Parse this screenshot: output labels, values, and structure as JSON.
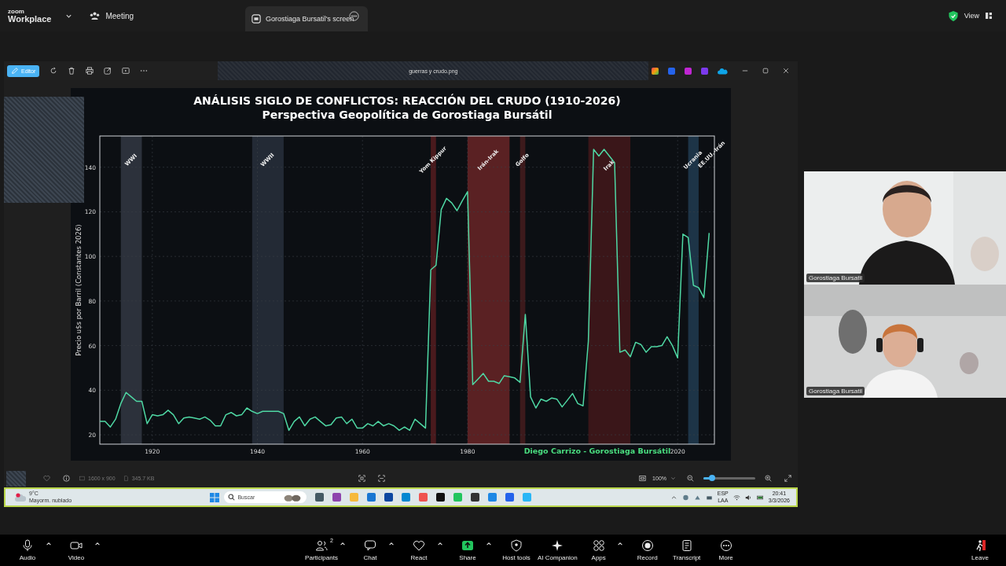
{
  "top_bar": {
    "logo_small": "zoom",
    "logo": "Workplace",
    "meeting": "Meeting",
    "share_tab": "Gorostiaga Bursatil's screen",
    "view": "View"
  },
  "viewer": {
    "editor_button": "Editor",
    "filename": "guerras y crudo.png",
    "image": {
      "subtitle": "Perspectiva Geopolítica de Gorostiaga Bursátil",
      "credit": "Diego Carrizo - Gorostiaga Bursátil",
      "chart_data": {
        "type": "line",
        "title": "ANÁLISIS SIGLO DE CONFLICTOS: REACCIÓN DEL CRUDO (1910-2026)",
        "ylabel": "Precio u$s por Barril (Constantes 2026)",
        "xlim": [
          1910,
          2027
        ],
        "ylim": [
          15.8,
          154
        ],
        "xticks": [
          1920,
          1940,
          1960,
          1980,
          2020
        ],
        "yticks": [
          20,
          40,
          60,
          80,
          100,
          120,
          140
        ],
        "x": [
          1910,
          1911,
          1912,
          1913,
          1914,
          1915,
          1916,
          1917,
          1918,
          1919,
          1920,
          1921,
          1922,
          1923,
          1924,
          1925,
          1926,
          1927,
          1928,
          1929,
          1930,
          1931,
          1932,
          1933,
          1934,
          1935,
          1936,
          1937,
          1938,
          1939,
          1940,
          1941,
          1942,
          1943,
          1944,
          1945,
          1946,
          1947,
          1948,
          1949,
          1950,
          1951,
          1952,
          1953,
          1954,
          1955,
          1956,
          1957,
          1958,
          1959,
          1960,
          1961,
          1962,
          1963,
          1964,
          1965,
          1966,
          1967,
          1968,
          1969,
          1970,
          1971,
          1972,
          1973,
          1974,
          1975,
          1976,
          1977,
          1978,
          1979,
          1980,
          1981,
          1982,
          1983,
          1984,
          1985,
          1986,
          1987,
          1988,
          1989,
          1990,
          1991,
          1992,
          1993,
          1994,
          1995,
          1996,
          1997,
          1998,
          1999,
          2000,
          2001,
          2002,
          2003,
          2004,
          2005,
          2006,
          2007,
          2008,
          2009,
          2010,
          2011,
          2012,
          2013,
          2014,
          2015,
          2016,
          2017,
          2018,
          2019,
          2020,
          2021,
          2022,
          2023,
          2024,
          2025,
          2026
        ],
        "series": [
          {
            "color": "#4fd8a4",
            "values": [
              26,
              26,
              23.5,
              27,
              34,
              39,
              37,
              35,
              35,
              25,
              29,
              28.5,
              29,
              31,
              29,
              25,
              27.5,
              28,
              27.5,
              27,
              28,
              26.5,
              24,
              24,
              29,
              30,
              28.5,
              29,
              32,
              30.5,
              29.5,
              30.5,
              30.5,
              30.5,
              30.5,
              29.5,
              22,
              26,
              28,
              24,
              27,
              28,
              26,
              24,
              24.5,
              27.5,
              28,
              25,
              27,
              23,
              23,
              25,
              24,
              26,
              24,
              25,
              24,
              22,
              23.5,
              22,
              27,
              25,
              23,
              94,
              96,
              121,
              126,
              124,
              120.5,
              125,
              129,
              42.5,
              45,
              47.5,
              44,
              44,
              43,
              46.5,
              46,
              45.5,
              43.5,
              74,
              37,
              32,
              36,
              35,
              36.5,
              36,
              32.5,
              35.5,
              38.5,
              34,
              33,
              62,
              148,
              145,
              148,
              145,
              142,
              57,
              58,
              55,
              61.5,
              60.5,
              57,
              59.5,
              59.5,
              60,
              64,
              60,
              54.5,
              110,
              108.5,
              87,
              86,
              81.5,
              110.5
            ]
          }
        ],
        "grid": true,
        "bands": [
          {
            "axis": "x",
            "from": 1914,
            "to": 1918,
            "label": "WWI",
            "color": "#2c313b"
          },
          {
            "axis": "x",
            "from": 1939,
            "to": 1945,
            "label": "WWII",
            "color": "#232a35"
          },
          {
            "axis": "x",
            "from": 1973,
            "to": 1974,
            "label": "Yom Kippur",
            "color": "#4a1a1d"
          },
          {
            "axis": "x",
            "from": 1980,
            "to": 1988,
            "label": "Irán-Irak",
            "color": "#5a2123"
          },
          {
            "axis": "x",
            "from": 1990,
            "to": 1991,
            "label": "Golfo",
            "color": "#3d1a1c"
          },
          {
            "axis": "x",
            "from": 2003,
            "to": 2011,
            "label": "Irak",
            "color": "#3a1619"
          },
          {
            "axis": "x",
            "from": 2022,
            "to": 2024,
            "label": "Ucrania",
            "color": "#1d3447"
          }
        ],
        "annotations": [
          {
            "text": "EE.UU.-Irán"
          }
        ]
      }
    },
    "dimensions": "1600 x 900",
    "file_size": "345.7 KB",
    "zoom": "100%",
    "zoom_slider": {
      "level": 0.16
    }
  },
  "taskbar": {
    "weather_temp": "9°C",
    "weather_text": "Mayorm. nublado",
    "search": {
      "placeholder": "Buscar"
    },
    "language": "ESP",
    "layout": "LAA",
    "time": "20:41",
    "date": "3/3/2026"
  },
  "videos": [
    {
      "name": "Gorostiaga Bursatil",
      "kind": "picture"
    },
    {
      "name": "Gorostiaga Bursatil",
      "kind": "picture"
    }
  ],
  "toolbar": [
    {
      "label": "Audio",
      "menu": true
    },
    {
      "label": "Video",
      "menu": true
    },
    {
      "label": "Participants",
      "count": "2",
      "menu": true
    },
    {
      "label": "Chat",
      "menu": true
    },
    {
      "label": "React",
      "menu": true
    },
    {
      "label": "Share",
      "menu": true
    },
    {
      "label": "Host tools",
      "menu": false
    },
    {
      "label": "AI Companion",
      "menu": false
    },
    {
      "label": "Apps",
      "menu": true
    },
    {
      "label": "Record",
      "menu": false
    },
    {
      "label": "Transcript",
      "menu": false
    },
    {
      "label": "More",
      "menu": false
    }
  ],
  "leave": "Leave"
}
